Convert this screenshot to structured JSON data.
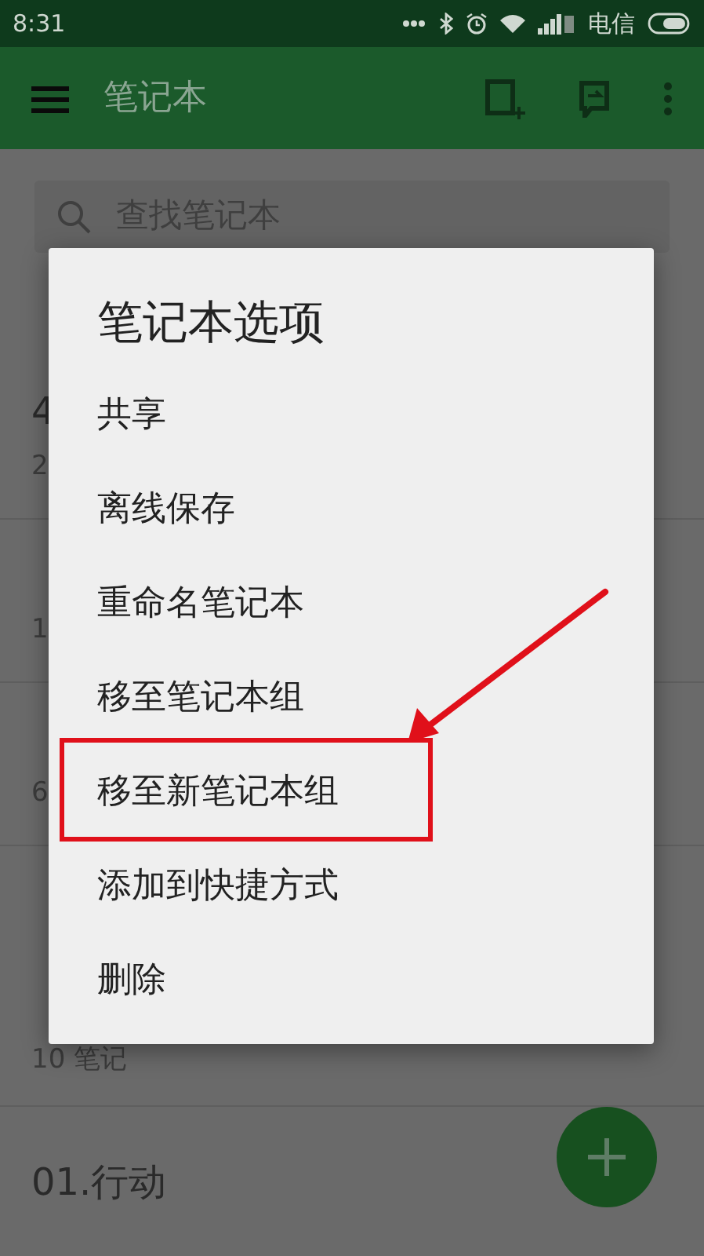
{
  "status_bar": {
    "time": "8:31",
    "carrier": "电信"
  },
  "app_bar": {
    "title": "笔记本"
  },
  "search": {
    "placeholder": "查找笔记本"
  },
  "list": [
    {
      "kind": "header"
    },
    {
      "kind": "row",
      "title": "4",
      "subtitle": "2"
    },
    {
      "kind": "row",
      "subtitle": "1"
    },
    {
      "kind": "row",
      "subtitle": "6"
    },
    {
      "kind": "header"
    },
    {
      "kind": "row",
      "subtitle": "10 笔记"
    },
    {
      "kind": "row",
      "title": "01.行动"
    }
  ],
  "dialog": {
    "title": "笔记本选项",
    "options": [
      {
        "label": "共享",
        "highlighted": false
      },
      {
        "label": "离线保存",
        "highlighted": false
      },
      {
        "label": "重命名笔记本",
        "highlighted": false
      },
      {
        "label": "移至笔记本组",
        "highlighted": false
      },
      {
        "label": "移至新笔记本组",
        "highlighted": true
      },
      {
        "label": "添加到快捷方式",
        "highlighted": false
      },
      {
        "label": "删除",
        "highlighted": false
      }
    ]
  }
}
